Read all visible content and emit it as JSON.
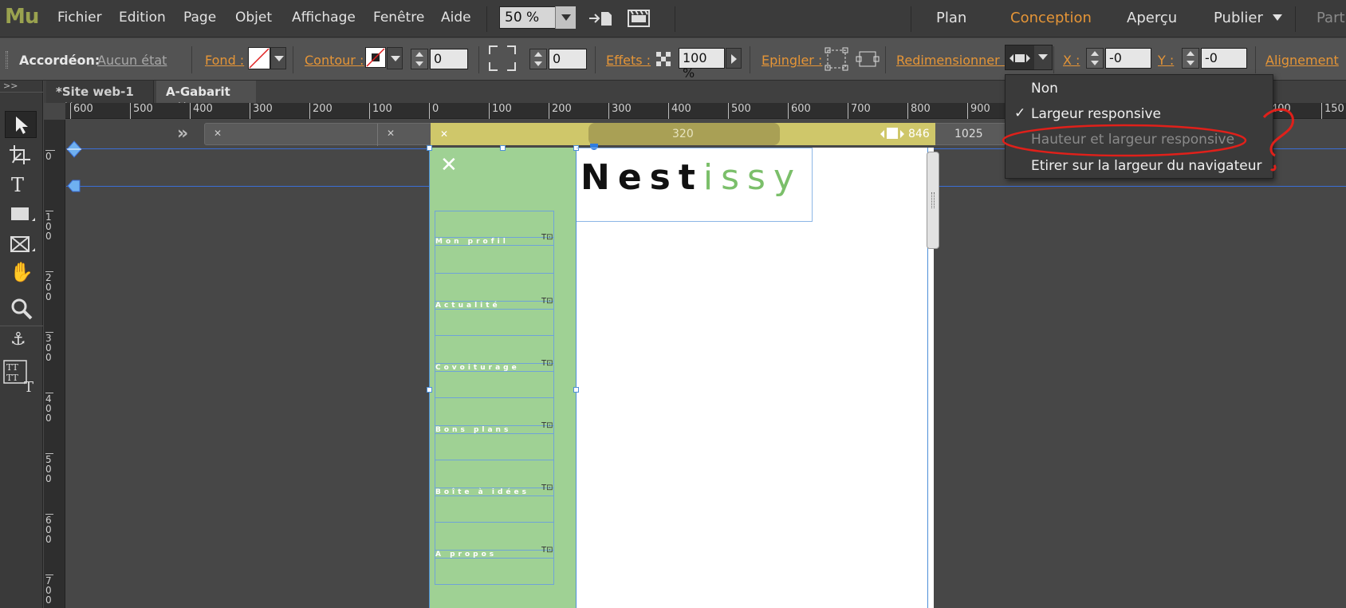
{
  "app": {
    "logo": "Mu"
  },
  "menubar": {
    "items": [
      "Fichier",
      "Edition",
      "Page",
      "Objet",
      "Affichage",
      "Fenêtre",
      "Aide"
    ],
    "zoom": "50 %",
    "modes": [
      "Plan",
      "Conception",
      "Aperçu",
      "Publier",
      "Part"
    ],
    "active_mode_color": "#e59537"
  },
  "controlbar": {
    "widget_label": "Accordéon:",
    "state": "Aucun état",
    "fond_label": "Fond :",
    "contour_label": "Contour :",
    "contour_value": "0",
    "corner_value": "0",
    "effets_label": "Effets :",
    "opacity": "100 %",
    "epingler_label": "Epingler :",
    "redim_label": "Redimensionner :",
    "x_label": "X :",
    "x_value": "-0",
    "y_label": "Y :",
    "y_value": "-0",
    "alignement_label": "Alignement"
  },
  "tabs": [
    {
      "label": "*Site web-1"
    },
    {
      "label": "A-Gabarit"
    }
  ],
  "ruler": {
    "h_labels": [
      "600",
      "500",
      "400",
      "300",
      "200",
      "100",
      "0",
      "100",
      "200",
      "300",
      "400",
      "500",
      "600",
      "700",
      "800",
      "900",
      "400",
      "150"
    ],
    "v_labels": [
      "0",
      "100",
      "200",
      "300",
      "400",
      "500",
      "600",
      "700"
    ]
  },
  "breakpoints": {
    "width_center": "320",
    "width_right": "846",
    "width_far": "1025"
  },
  "canvas": {
    "logo_bold": "Nest",
    "logo_light": "issy",
    "close": "✕",
    "menu_items": [
      "Mon profil",
      "Actualité",
      "Covoiturage",
      "Bons plans",
      "Boîte à idées",
      "A propos"
    ]
  },
  "dropdown": {
    "items": [
      {
        "label": "Non",
        "checked": false,
        "disabled": false
      },
      {
        "label": "Largeur responsive",
        "checked": true,
        "disabled": false
      },
      {
        "label": "Hauteur et largeur responsive",
        "checked": false,
        "disabled": true
      },
      {
        "label": "Etirer sur la largeur du navigateur",
        "checked": false,
        "disabled": false
      }
    ],
    "check": "✓"
  },
  "colors": {
    "accent": "#e59537",
    "sidebar_green": "#9fd194",
    "logo_green": "#7bbf6a",
    "annotation_red": "#e0201a"
  }
}
